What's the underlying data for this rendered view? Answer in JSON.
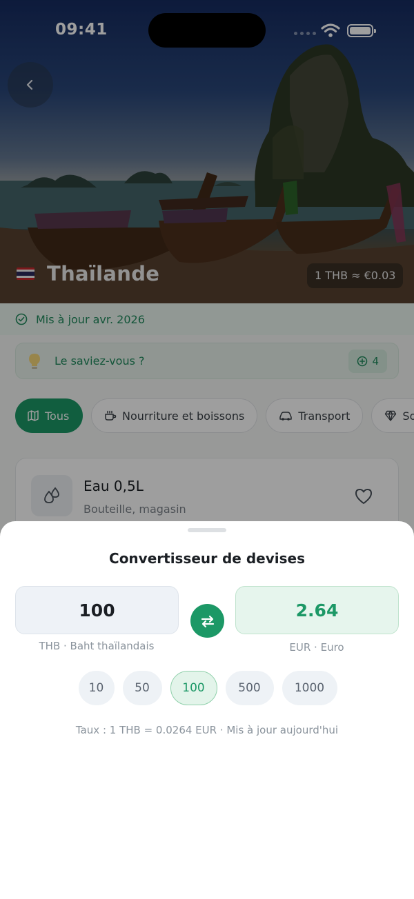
{
  "status_bar": {
    "time": "09:41"
  },
  "hero": {
    "country": "Thaïlande",
    "flag_colors": [
      "#c8282c",
      "#f2f2f2",
      "#2d2a5d"
    ],
    "rate_chip": "1 THB ≈ €0.03"
  },
  "updated": {
    "text": "Mis à jour avr. 2026"
  },
  "tip": {
    "text": "Le saviez-vous ?",
    "count": "4"
  },
  "filters": [
    {
      "label": "Tous",
      "icon": "map-icon",
      "active": true
    },
    {
      "label": "Nourriture et boissons",
      "icon": "coffee-icon",
      "active": false
    },
    {
      "label": "Transport",
      "icon": "car-icon",
      "active": false
    },
    {
      "label": "So",
      "icon": "diamond-icon",
      "active": false
    }
  ],
  "item": {
    "title": "Eau 0,5L",
    "subtitle": "Bouteille, magasin",
    "icon": "water-drops-icon"
  },
  "converter": {
    "title": "Convertisseur de devises",
    "from_amount": "100",
    "to_amount": "2.64",
    "from_currency": "THB · Baht thaïlandais",
    "to_currency": "EUR · Euro",
    "presets": [
      "10",
      "50",
      "100",
      "500",
      "1000"
    ],
    "selected_preset": "100",
    "rate_text": "Taux : 1 THB = 0.0264 EUR · Mis à jour aujourd'hui"
  },
  "colors": {
    "accent": "#1c9866",
    "accent_light": "#e6f5ed"
  }
}
